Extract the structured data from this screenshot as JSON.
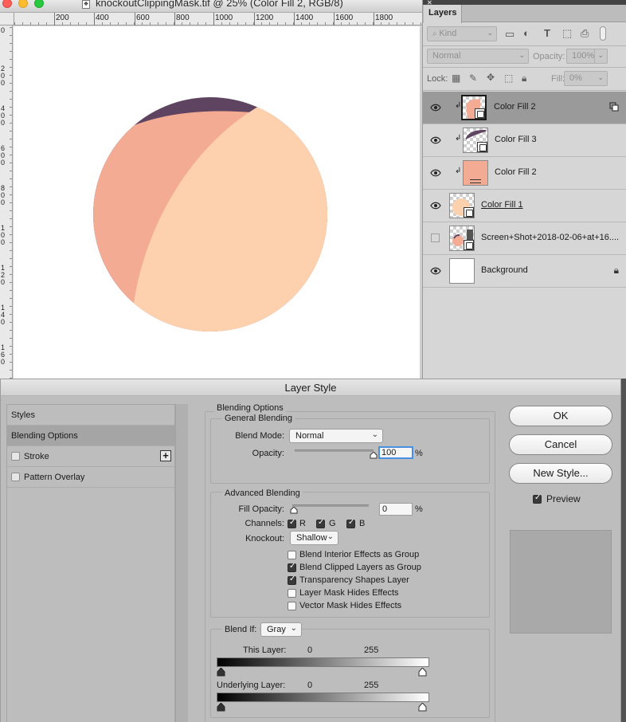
{
  "document": {
    "title": "knockoutClippingMask.tif @ 25% (Color Fill 2, RGB/8)",
    "file_icon": "document-icon",
    "ruler_top_labels": [
      "200",
      "400",
      "600",
      "800",
      "1000",
      "1200",
      "1400",
      "1600",
      "1800"
    ],
    "ruler_left_labels": [
      "0",
      "2 0 0",
      "4 0 0",
      "6 0 0",
      "8 0 0",
      "1 0 0",
      "1 2 0",
      "1 4 0",
      "1 6 0"
    ],
    "artwork_colors": {
      "dark": "#5f4461",
      "salmon": "#f4ab93",
      "peach": "#fdd1ad"
    }
  },
  "layers_panel": {
    "tab_label": "Layers",
    "kind_label": "Kind",
    "blend_mode": "Normal",
    "opacity_label": "Opacity:",
    "opacity_value": "100%",
    "lock_label": "Lock:",
    "fill_label": "Fill:",
    "fill_value": "0%",
    "layers": [
      {
        "name": "Color Fill 2",
        "visible": true,
        "clipped": true,
        "selected": true
      },
      {
        "name": "Color Fill 3",
        "visible": true,
        "clipped": true,
        "selected": false
      },
      {
        "name": "Color Fill 2",
        "visible": true,
        "clipped": true,
        "selected": false
      },
      {
        "name": "Color Fill 1",
        "visible": true,
        "clipped": false,
        "selected": false
      },
      {
        "name": "Screen+Shot+2018-02-06+at+16....",
        "visible": false,
        "clipped": false,
        "selected": false
      },
      {
        "name": "Background",
        "visible": true,
        "clipped": false,
        "selected": false,
        "locked": true
      }
    ]
  },
  "dialog": {
    "title": "Layer Style",
    "styles_list": [
      {
        "label": "Styles"
      },
      {
        "label": "Blending Options",
        "selected": true
      },
      {
        "label": "Stroke",
        "checked": false
      },
      {
        "label": "Pattern Overlay",
        "checked": false
      }
    ],
    "blending_options": {
      "section_title": "Blending Options",
      "general_title": "General Blending",
      "blend_mode_label": "Blend Mode:",
      "blend_mode_value": "Normal",
      "opacity_label": "Opacity:",
      "opacity_value": "100",
      "opacity_percent": 100,
      "advanced_title": "Advanced Blending",
      "fill_opacity_label": "Fill Opacity:",
      "fill_opacity_value": "0",
      "fill_opacity_percent": 0,
      "channels_label": "Channels:",
      "channels": [
        {
          "label": "R",
          "checked": true
        },
        {
          "label": "G",
          "checked": true
        },
        {
          "label": "B",
          "checked": true
        }
      ],
      "knockout_label": "Knockout:",
      "knockout_value": "Shallow",
      "options": [
        {
          "label": "Blend Interior Effects as Group",
          "checked": false
        },
        {
          "label": "Blend Clipped Layers as Group",
          "checked": true
        },
        {
          "label": "Transparency Shapes Layer",
          "checked": true
        },
        {
          "label": "Layer Mask Hides Effects",
          "checked": false
        },
        {
          "label": "Vector Mask Hides Effects",
          "checked": false
        }
      ],
      "blend_if_label": "Blend If:",
      "blend_if_value": "Gray",
      "this_layer_label": "This Layer:",
      "this_layer_min": "0",
      "this_layer_max": "255",
      "underlying_label": "Underlying Layer:",
      "underlying_min": "0",
      "underlying_max": "255"
    },
    "buttons": {
      "ok": "OK",
      "cancel": "Cancel",
      "new_style": "New Style..."
    },
    "preview_label": "Preview",
    "preview_checked": true
  },
  "percent_sign": "%"
}
